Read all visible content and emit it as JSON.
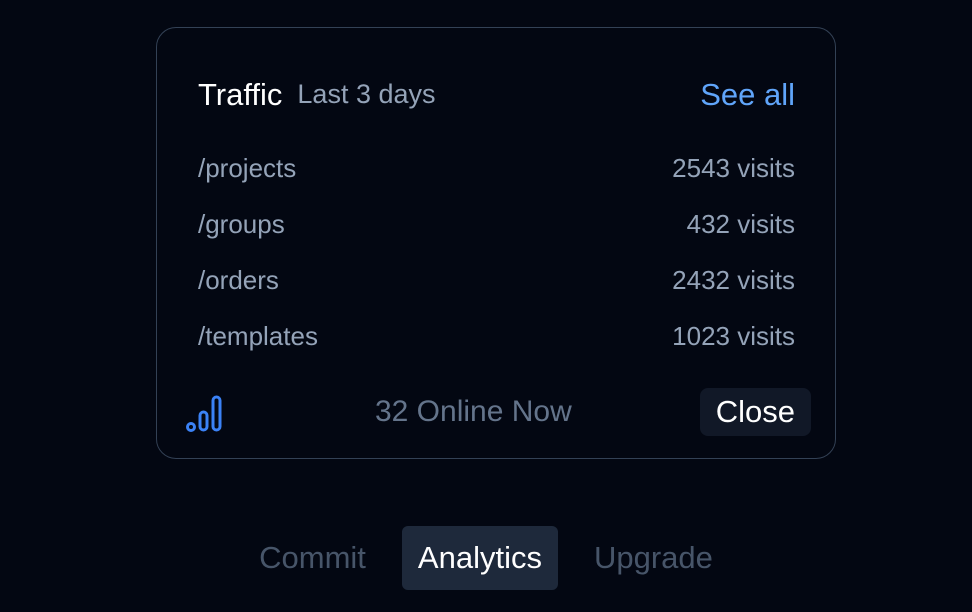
{
  "card": {
    "title": "Traffic",
    "subtitle": "Last 3 days",
    "see_all": "See all",
    "rows": [
      {
        "path": "/projects",
        "visits": "2543 visits"
      },
      {
        "path": "/groups",
        "visits": "432 visits"
      },
      {
        "path": "/orders",
        "visits": "2432 visits"
      },
      {
        "path": "/templates",
        "visits": "1023 visits"
      }
    ],
    "footer": {
      "icon": "signal-bars-icon",
      "online_text": "32 Online Now",
      "close_label": "Close"
    }
  },
  "tabs": [
    {
      "label": "Commit",
      "active": false
    },
    {
      "label": "Analytics",
      "active": true
    },
    {
      "label": "Upgrade",
      "active": false
    }
  ],
  "colors": {
    "background": "#030712",
    "accent": "#60a5fa",
    "icon": "#3b82f6",
    "muted": "#94a3b8"
  }
}
